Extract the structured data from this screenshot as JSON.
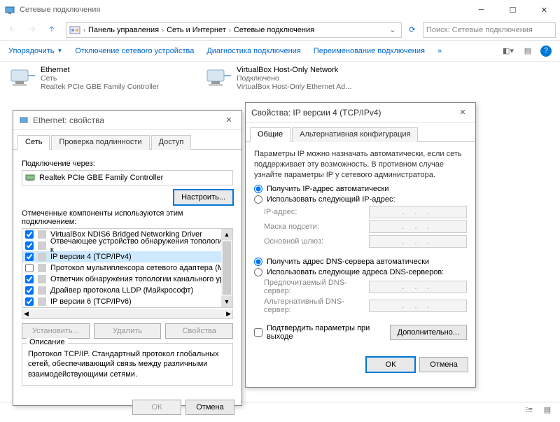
{
  "window": {
    "title": "Сетевые подключения",
    "nav": {
      "breadcrumb": [
        "Панель управления",
        "Сеть и Интернет",
        "Сетевые подключения"
      ],
      "search_placeholder": "Поиск: Сетевые подключения"
    },
    "commands": {
      "organize": "Упорядочить",
      "disable": "Отключение сетевого устройства",
      "diagnose": "Диагностика подключения",
      "rename": "Переименование подключения"
    }
  },
  "connections": [
    {
      "name": "Ethernet",
      "status": "Сеть",
      "device": "Realtek PCIe GBE Family Controller"
    },
    {
      "name": "VirtualBox Host-Only Network",
      "status": "Подключено",
      "device": "VirtualBox Host-Only Ethernet Ad..."
    }
  ],
  "eth_dialog": {
    "title": "Ethernet: свойства",
    "tabs": {
      "net": "Сеть",
      "auth": "Проверка подлинности",
      "access": "Доступ"
    },
    "connect_via": "Подключение через:",
    "adapter": "Realtek PCIe GBE Family Controller",
    "configure_btn": "Настроить...",
    "components_label": "Отмеченные компоненты используются этим подключением:",
    "components": [
      "VirtualBox NDIS6 Bridged Networking Driver",
      "Отвечающее устройство обнаружения топологии к",
      "IP версии 4 (TCP/IPv4)",
      "Протокол мультиплексора сетевого адаптера (Ма",
      "Ответчик обнаружения топологии канального уро‎",
      "Драйвер протокола LLDP (Майкрософт)",
      "IP версии 6 (TCP/IPv6)"
    ],
    "install_btn": "Установить...",
    "remove_btn": "Удалить",
    "props_btn": "Свойства",
    "desc_legend": "Описание",
    "description": "Протокол TCP/IP. Стандартный протокол глобальных сетей, обеспечивающий связь между различными взаимодействующими сетями.",
    "ok": "ОК",
    "cancel": "Отмена"
  },
  "ipv4_dialog": {
    "title": "Свойства: IP версии 4 (TCP/IPv4)",
    "tabs": {
      "general": "Общие",
      "alt": "Альтернативная конфигурация"
    },
    "info": "Параметры IP можно назначать автоматически, если сеть поддерживает эту возможность. В противном случае узнайте параметры IP у сетевого администратора.",
    "radio_ip_auto": "Получить IP-адрес автоматически",
    "radio_ip_manual": "Использовать следующий IP-адрес:",
    "ip_label": "IP-адрес:",
    "mask_label": "Маска подсети:",
    "gw_label": "Основной шлюз:",
    "radio_dns_auto": "Получить адрес DNS-сервера автоматически",
    "radio_dns_manual": "Использовать следующие адреса DNS-серверов:",
    "dns1_label": "Предпочитаемый DNS-сервер:",
    "dns2_label": "Альтернативный DNS-сервер:",
    "confirm_label": "Подтвердить параметры при выходе",
    "advanced_btn": "Дополнительно...",
    "ok": "ОК",
    "cancel": "Отмена"
  }
}
